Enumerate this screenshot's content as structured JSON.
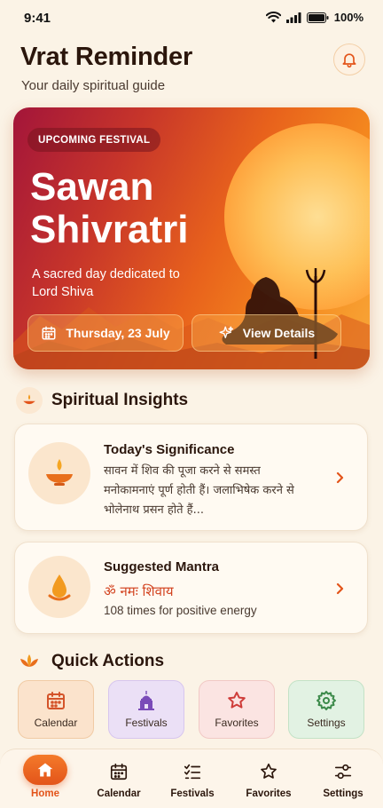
{
  "status": {
    "time": "9:41",
    "battery": "100%"
  },
  "header": {
    "title": "Vrat Reminder",
    "subtitle": "Your daily spiritual guide"
  },
  "hero": {
    "badge": "UPCOMING FESTIVAL",
    "title": "Sawan Shivratri",
    "description": "A sacred day dedicated to Lord Shiva",
    "date_label": "Thursday, 23 July",
    "details_label": "View Details"
  },
  "insights": {
    "title": "Spiritual Insights",
    "significance": {
      "title": "Today's Significance",
      "text": "सावन में शिव की पूजा करने से समस्त मनोकामनाएं पूर्ण होती हैं। जलाभिषेक करने से भोलेनाथ प्रसन होते हैं..."
    },
    "mantra": {
      "title": "Suggested Mantra",
      "mantra": "ॐ नमः शिवाय",
      "note": "108 times for positive energy"
    }
  },
  "quick_actions": {
    "title": "Quick Actions",
    "items": [
      {
        "label": "Calendar",
        "icon": "calendar-icon",
        "bg": "#fbe3cc",
        "border": "#f1cba5",
        "color": "#d4542a"
      },
      {
        "label": "Festivals",
        "icon": "temple-icon",
        "bg": "#ebe0f6",
        "border": "#d7c6ee",
        "color": "#7a4bb8"
      },
      {
        "label": "Favorites",
        "icon": "star-icon",
        "bg": "#fbe4e2",
        "border": "#f1c9c5",
        "color": "#cf3d3a"
      },
      {
        "label": "Settings",
        "icon": "gear-icon",
        "bg": "#e2f2e3",
        "border": "#c3e2c6",
        "color": "#3c8a4a"
      }
    ]
  },
  "nav": {
    "items": [
      {
        "label": "Home",
        "icon": "home-icon"
      },
      {
        "label": "Calendar",
        "icon": "calendar-icon"
      },
      {
        "label": "Festivals",
        "icon": "list-check-icon"
      },
      {
        "label": "Favorites",
        "icon": "star-icon"
      },
      {
        "label": "Settings",
        "icon": "sliders-icon"
      }
    ],
    "active": "Home"
  },
  "colors": {
    "accent": "#e3541a",
    "background": "#fbf3e6",
    "text": "#2b160c"
  }
}
